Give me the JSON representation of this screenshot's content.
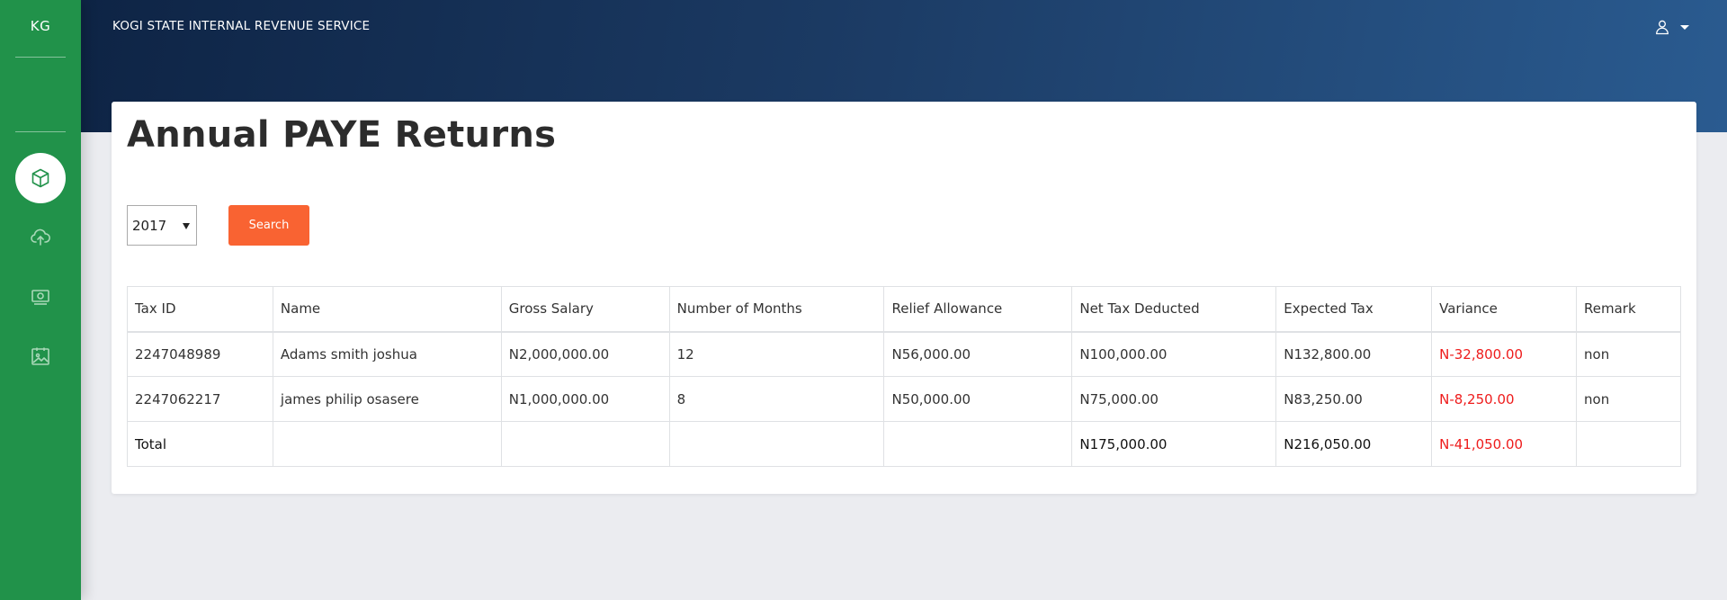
{
  "sidebar": {
    "brand": "KG",
    "nav": [
      {
        "icon": "box-icon",
        "active": true
      },
      {
        "icon": "cloud-upload-icon",
        "active": false
      },
      {
        "icon": "money-icon",
        "active": false
      },
      {
        "icon": "image-icon",
        "active": false
      }
    ]
  },
  "header": {
    "title": "KOGI STATE INTERNAL REVENUE SERVICE",
    "user_icon": "user-icon"
  },
  "page": {
    "title": "Annual PAYE Returns",
    "year_select": {
      "value": "2017"
    },
    "search_label": "Search"
  },
  "table": {
    "columns": [
      "Tax ID",
      "Name",
      "Gross Salary",
      "Number of Months",
      "Relief Allowance",
      "Net Tax Deducted",
      "Expected Tax",
      "Variance",
      "Remark"
    ],
    "rows": [
      {
        "tax_id": "2247048989",
        "name": "Adams smith joshua",
        "gross": "N2,000,000.00",
        "months": "12",
        "relief": "N56,000.00",
        "net_tax": "N100,000.00",
        "expected": "N132,800.00",
        "variance": "N-32,800.00",
        "remark": "non"
      },
      {
        "tax_id": "2247062217",
        "name": "james philip osasere",
        "gross": "N1,000,000.00",
        "months": "8",
        "relief": "N50,000.00",
        "net_tax": "N75,000.00",
        "expected": "N83,250.00",
        "variance": "N-8,250.00",
        "remark": "non"
      }
    ],
    "total": {
      "label": "Total",
      "net_tax": "N175,000.00",
      "expected": "N216,050.00",
      "variance": "N-41,050.00"
    }
  },
  "colors": {
    "sidebar": "#21924a",
    "header_start": "#0e2445",
    "header_end": "#2a5b90",
    "accent_button": "#f96332",
    "negative": "#ee1c1c"
  }
}
